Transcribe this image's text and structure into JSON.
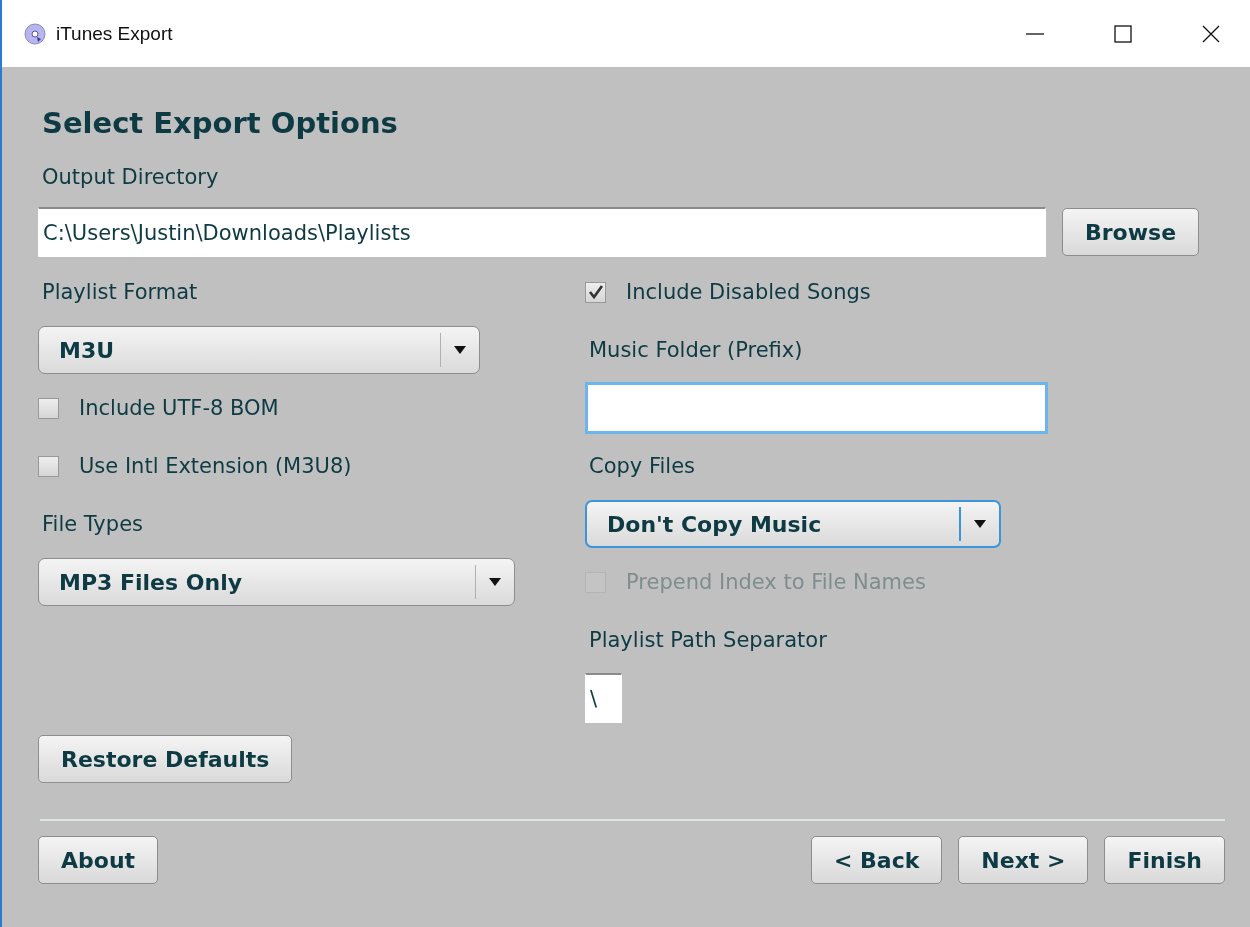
{
  "window": {
    "title": "iTunes Export"
  },
  "heading": "Select Export Options",
  "output_directory": {
    "label": "Output Directory",
    "value": "C:\\Users\\Justin\\Downloads\\Playlists",
    "browse": "Browse"
  },
  "left": [
    {
      "kind": "label",
      "text": "Playlist Format"
    },
    {
      "kind": "select",
      "value": "M3U",
      "focused": false
    },
    {
      "kind": "checkbox",
      "text": "Include UTF-8 BOM",
      "checked": false,
      "disabled": false
    },
    {
      "kind": "checkbox",
      "text": "Use Intl Extension (M3U8)",
      "checked": false,
      "disabled": false
    },
    {
      "kind": "label",
      "text": "File Types"
    },
    {
      "kind": "select",
      "value": "MP3 Files Only",
      "focused": false
    }
  ],
  "right": [
    {
      "kind": "checkbox",
      "text": "Include Disabled Songs",
      "checked": true,
      "disabled": false
    },
    {
      "kind": "label",
      "text": "Music Folder (Prefix)"
    },
    {
      "kind": "input",
      "focused": true
    },
    {
      "kind": "label",
      "text": "Copy Files"
    },
    {
      "kind": "select",
      "value": "Don't Copy Music",
      "focused": true
    },
    {
      "kind": "checkbox",
      "text": "Prepend Index to File Names",
      "checked": false,
      "disabled": true
    },
    {
      "kind": "label",
      "text": "Playlist Path Separator"
    },
    {
      "kind": "input",
      "value": "\\",
      "focused": false
    }
  ],
  "restore_button": "Restore Defaults",
  "footer": {
    "left_buttons": [
      "About"
    ],
    "right_buttons": [
      "< Back",
      "Next >",
      "Finish"
    ]
  }
}
